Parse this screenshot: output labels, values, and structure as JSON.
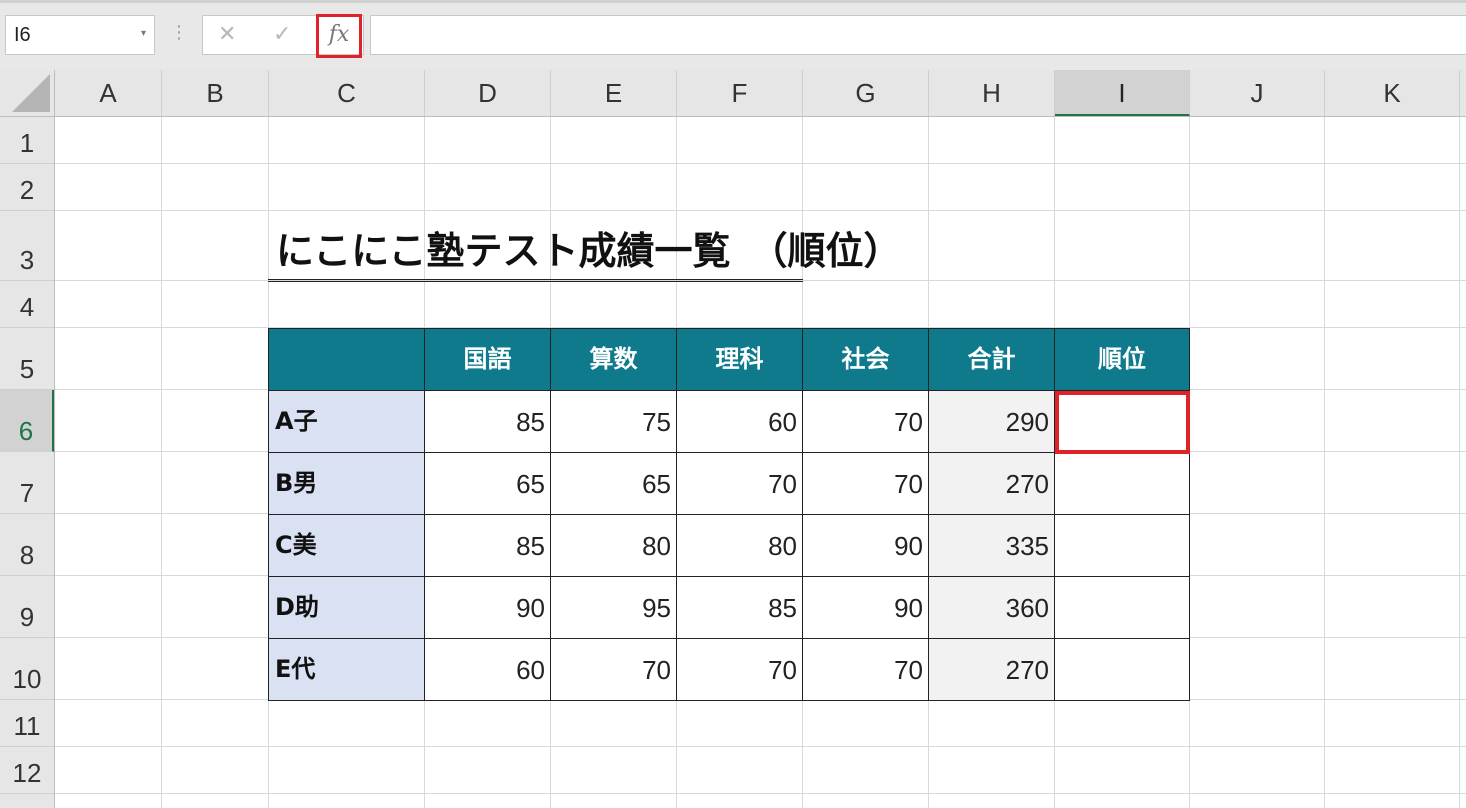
{
  "formula_bar": {
    "name_box": "I6",
    "name_box_arrow": "▾",
    "separator": "⋮",
    "cancel_icon": "✕",
    "enter_icon": "✓",
    "fx_label": "fx",
    "formula": ""
  },
  "columns": [
    "A",
    "B",
    "C",
    "D",
    "E",
    "F",
    "G",
    "H",
    "I",
    "J",
    "K"
  ],
  "rows": [
    "1",
    "2",
    "3",
    "4",
    "5",
    "6",
    "7",
    "8",
    "9",
    "10",
    "11",
    "12"
  ],
  "active_cell": "I6",
  "sheet": {
    "title": "にこにこ塾テスト成績一覧　（順位）",
    "table": {
      "headers": [
        "",
        "国語",
        "算数",
        "理科",
        "社会",
        "合計",
        "順位"
      ],
      "rows": [
        {
          "name": "A子",
          "scores": [
            "85",
            "75",
            "60",
            "70"
          ],
          "total": "290",
          "rank": ""
        },
        {
          "name": "B男",
          "scores": [
            "65",
            "65",
            "70",
            "70"
          ],
          "total": "270",
          "rank": ""
        },
        {
          "name": "C美",
          "scores": [
            "85",
            "80",
            "80",
            "90"
          ],
          "total": "335",
          "rank": ""
        },
        {
          "name": "D助",
          "scores": [
            "90",
            "95",
            "85",
            "90"
          ],
          "total": "360",
          "rank": ""
        },
        {
          "name": "E代",
          "scores": [
            "60",
            "70",
            "70",
            "70"
          ],
          "total": "270",
          "rank": ""
        }
      ]
    }
  },
  "colors": {
    "header_fill": "#0e7a8c",
    "name_fill": "#d9e1f2",
    "total_fill": "#f2f2f2",
    "highlight": "#e0222a",
    "active_accent": "#217346"
  }
}
